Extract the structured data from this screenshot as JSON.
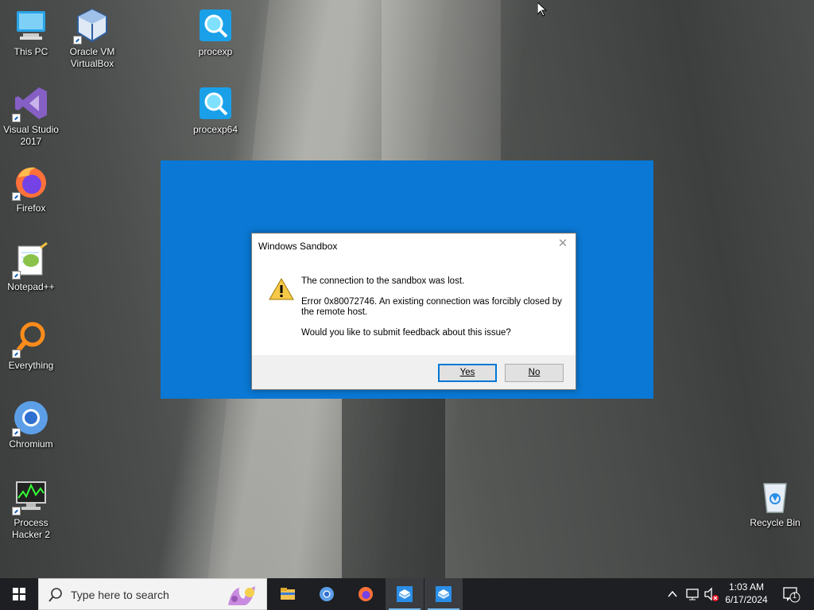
{
  "desktop": {
    "icons": [
      {
        "label": "This PC"
      },
      {
        "label": "Oracle VM VirtualBox"
      },
      {
        "label": "procexp"
      },
      {
        "label": "procexp64"
      },
      {
        "label": "Visual Studio 2017"
      },
      {
        "label": "Firefox"
      },
      {
        "label": "Notepad++"
      },
      {
        "label": "Everything"
      },
      {
        "label": "Chromium"
      },
      {
        "label": "Process Hacker 2"
      },
      {
        "label": "Recycle Bin"
      }
    ]
  },
  "dialog": {
    "title": "Windows Sandbox",
    "close_glyph": "✕",
    "message_main": "The connection to the sandbox was lost.",
    "message_error": "Error 0x80072746. An existing connection was forcibly closed by the remote host.",
    "message_question": "Would you like to submit feedback about this issue?",
    "yes_label": "Yes",
    "no_label": "No"
  },
  "taskbar": {
    "search_placeholder": "Type here to search",
    "apps": [
      "File Explorer",
      "Chromium",
      "Firefox",
      "Windows Sandbox",
      "Windows Sandbox"
    ],
    "time": "1:03 AM",
    "date": "6/17/2024",
    "notification_count": "1"
  },
  "colors": {
    "sandbox_blue": "#0a78d4",
    "taskbar": "#1d1f22",
    "accent": "#0078d7"
  }
}
